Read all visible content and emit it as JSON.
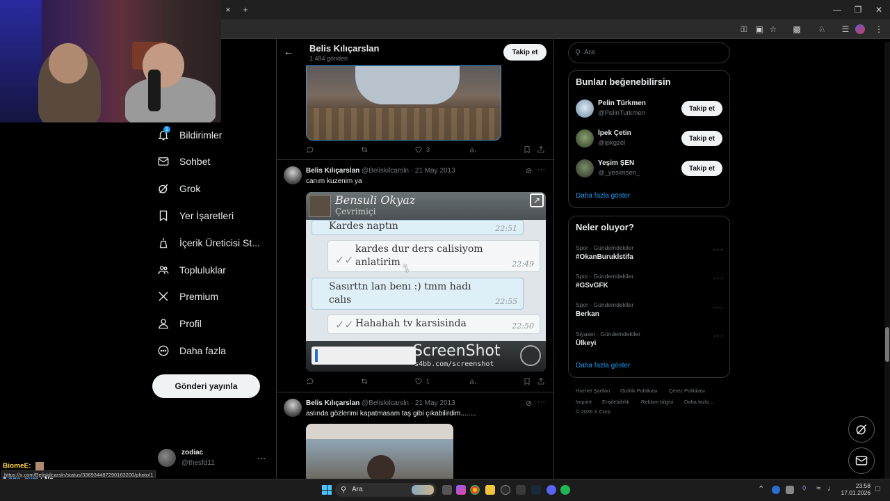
{
  "browser": {
    "new_tab_label": "+",
    "close_tab_label": "×",
    "status_url": "https://x.com/Beliskilcarsln/status/336934487290163200/photo/1"
  },
  "nav": {
    "items": [
      {
        "label": "Bildirimler",
        "icon": "bell-icon",
        "badge": "1"
      },
      {
        "label": "Sohbet",
        "icon": "mail-icon"
      },
      {
        "label": "Grok",
        "icon": "grok-icon"
      },
      {
        "label": "Yer İşaretleri",
        "icon": "bookmark-icon"
      },
      {
        "label": "İçerik Üreticisi St...",
        "icon": "creator-studio-icon"
      },
      {
        "label": "Topluluklar",
        "icon": "communities-icon"
      },
      {
        "label": "Premium",
        "icon": "x-logo-icon"
      },
      {
        "label": "Profil",
        "icon": "profile-icon"
      },
      {
        "label": "Daha fazla",
        "icon": "more-circle-icon"
      }
    ],
    "post_button": "Gönderi yayınla",
    "account": {
      "name": "zodiac",
      "handle": "@thesfd11",
      "menu": "···"
    }
  },
  "profile_header": {
    "name": "Belis Kılıçarslan",
    "post_count": "1.484 gönderi",
    "follow": "Takip et"
  },
  "tweets": [
    {
      "likes": "3"
    },
    {
      "name": "Belis Kılıçarslan",
      "handle": "@Beliskilcarsln",
      "date": "· 21 May 2013",
      "text": "canım kuzenim ya",
      "likes": "1",
      "image": {
        "contact": "Bensuli Okyaz",
        "status": "Çevrimiçi",
        "messages": [
          {
            "text": "Kardes naptın",
            "time": "22:51"
          },
          {
            "text": "kardes dur ders calisiyom anlatirim",
            "time": "22:49"
          },
          {
            "text": "Sasırttn lan benı :) tmm hadı calıs",
            "time": "22:55"
          },
          {
            "text": "Hahahah tv karsisinda",
            "time": "22:50"
          }
        ],
        "watermark": "ScreenShot",
        "watermark_sub": "s4bb.com/screenshot"
      }
    },
    {
      "name": "Belis Kılıçarslan",
      "handle": "@Beliskilcarsln",
      "date": "· 21 May 2013",
      "text": "aslında gözlerimi kapatmasam taş gibi çıkabilirdim........"
    }
  ],
  "search": {
    "placeholder": "Ara"
  },
  "suggestions": {
    "title": "Bunları beğenebilirsin",
    "users": [
      {
        "name": "Pelin Türkmen",
        "handle": "@PelinTurkmen",
        "follow": "Takip et"
      },
      {
        "name": "İpek Çetin",
        "handle": "@ipkgzel",
        "follow": "Takip et"
      },
      {
        "name": "Yeşim ŞEN",
        "handle": "@_yesimsen_",
        "follow": "Takip et"
      }
    ],
    "show_more": "Daha fazla göster"
  },
  "trends": {
    "title": "Neler oluyor?",
    "items": [
      {
        "category": "Spor · Gündemdekiler",
        "name": "#OkanBurukİstifa"
      },
      {
        "category": "Spor · Gündemdekiler",
        "name": "#GSvGFK"
      },
      {
        "category": "Spor · Gündemdekiler",
        "name": "Berkan"
      },
      {
        "category": "Siyaset · Gündemdekiler",
        "name": "Ülkeyi"
      }
    ],
    "show_more": "Daha fazla göster"
  },
  "footer": {
    "links": [
      "Hizmet Şartları",
      "Gizlilik Politikası",
      "Çerez Politikası",
      "Imprint",
      "Erişilebilirlik",
      "Reklam bilgisi",
      "Daha fazla ..."
    ],
    "copyright": "© 2026 X Corp."
  },
  "stream_chat": [
    {
      "user": "BiomeE",
      "sep": ":",
      "msg": ""
    },
    {
      "user": "ege_eym",
      "sep": ":",
      "msg": "Ne"
    }
  ],
  "taskbar": {
    "search_label": "Ara",
    "time": "23:58",
    "date": "17.01.2026"
  },
  "colors": {
    "accent": "#1d9bf0",
    "background": "#000000",
    "text": "#e7e9ea",
    "muted": "#71767b"
  }
}
